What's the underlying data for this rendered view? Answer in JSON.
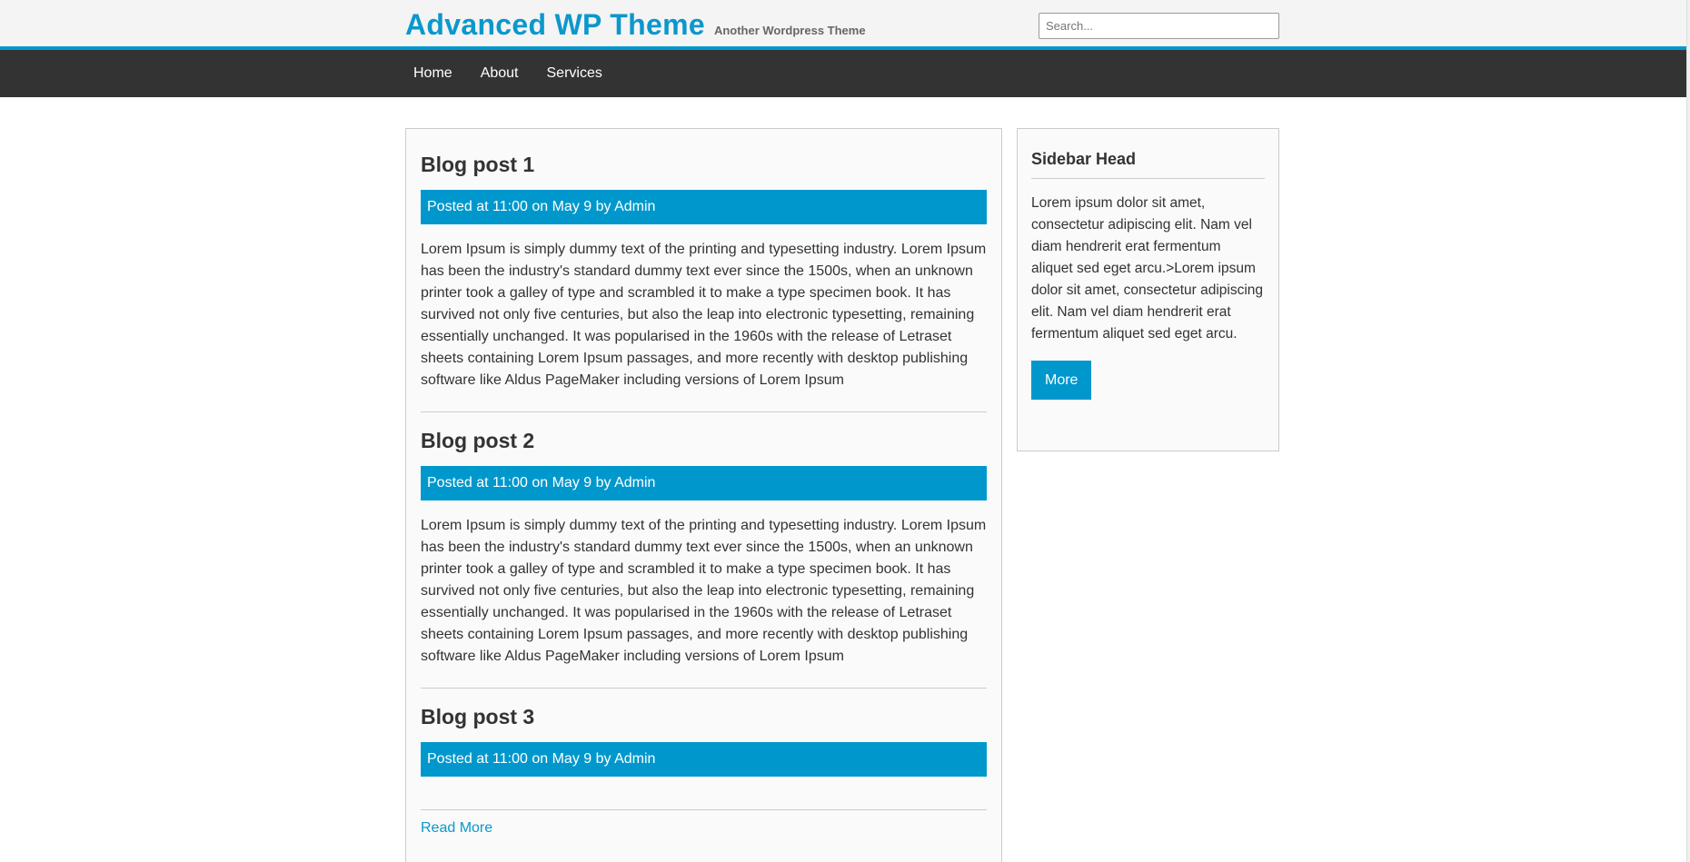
{
  "header": {
    "site_title": "Advanced WP Theme",
    "tagline": "Another Wordpress Theme",
    "search_placeholder": "Search..."
  },
  "nav": {
    "items": [
      {
        "label": "Home"
      },
      {
        "label": "About"
      },
      {
        "label": "Services"
      }
    ]
  },
  "posts": [
    {
      "title": "Blog post 1",
      "meta": "Posted at 11:00 on May 9 by Admin",
      "body": "Lorem Ipsum is simply dummy text of the printing and typesetting industry. Lorem Ipsum has been the industry's standard dummy text ever since the 1500s, when an unknown printer took a galley of type and scrambled it to make a type specimen book. It has survived not only five centuries, but also the leap into electronic typesetting, remaining essentially unchanged. It was popularised in the 1960s with the release of Letraset sheets containing Lorem Ipsum passages, and more recently with desktop publishing software like Aldus PageMaker including versions of Lorem Ipsum"
    },
    {
      "title": "Blog post 2",
      "meta": "Posted at 11:00 on May 9 by Admin",
      "body": "Lorem Ipsum is simply dummy text of the printing and typesetting industry. Lorem Ipsum has been the industry's standard dummy text ever since the 1500s, when an unknown printer took a galley of type and scrambled it to make a type specimen book. It has survived not only five centuries, but also the leap into electronic typesetting, remaining essentially unchanged. It was popularised in the 1960s with the release of Letraset sheets containing Lorem Ipsum passages, and more recently with desktop publishing software like Aldus PageMaker including versions of Lorem Ipsum"
    },
    {
      "title": "Blog post 3",
      "meta": "Posted at 11:00 on May 9 by Admin",
      "body": ""
    }
  ],
  "read_more": "Read More",
  "sidebar": {
    "head": "Sidebar Head",
    "text": "Lorem ipsum dolor sit amet, consectetur adipiscing elit. Nam vel diam hendrerit erat fermentum aliquet sed eget arcu.>Lorem ipsum dolor sit amet, consectetur adipiscing elit. Nam vel diam hendrerit erat fermentum aliquet sed eget arcu.",
    "button_label": "More"
  },
  "colors": {
    "accent": "#0098cc",
    "nav_background": "#333333",
    "header_background": "#f4f4f4",
    "panel_background": "#fafafa"
  }
}
